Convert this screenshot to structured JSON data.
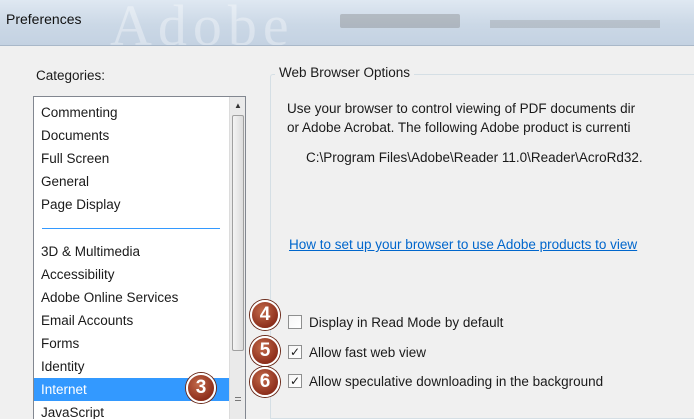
{
  "window": {
    "title": "Preferences"
  },
  "categories": {
    "label": "Categories:",
    "group1": [
      "Commenting",
      "Documents",
      "Full Screen",
      "General",
      "Page Display"
    ],
    "group2": [
      "3D & Multimedia",
      "Accessibility",
      "Adobe Online Services",
      "Email Accounts",
      "Forms",
      "Identity",
      "Internet",
      "JavaScript"
    ],
    "selected": "Internet"
  },
  "web_browser_options": {
    "legend": "Web Browser Options",
    "description_line1": "Use your browser to control viewing of PDF documents dir",
    "description_line2": "or Adobe Acrobat. The following Adobe product is currenti",
    "product_path": "C:\\Program Files\\Adobe\\Reader 11.0\\Reader\\AcroRd32.",
    "help_link": "How to set up your browser to use Adobe products to view"
  },
  "options": [
    {
      "label": "Display in Read Mode by default",
      "checked": false,
      "callout": "4"
    },
    {
      "label": "Allow fast web view",
      "checked": true,
      "callout": "5"
    },
    {
      "label": "Allow speculative downloading in the background",
      "checked": true,
      "callout": "6"
    }
  ],
  "category_callout": "3",
  "colors": {
    "selection": "#3399ff",
    "link": "#0066cc",
    "badge": "#8e2f1c"
  },
  "icons": {
    "scroll_up": "scroll-up-arrow-icon",
    "checkmark": "checkmark-icon"
  }
}
